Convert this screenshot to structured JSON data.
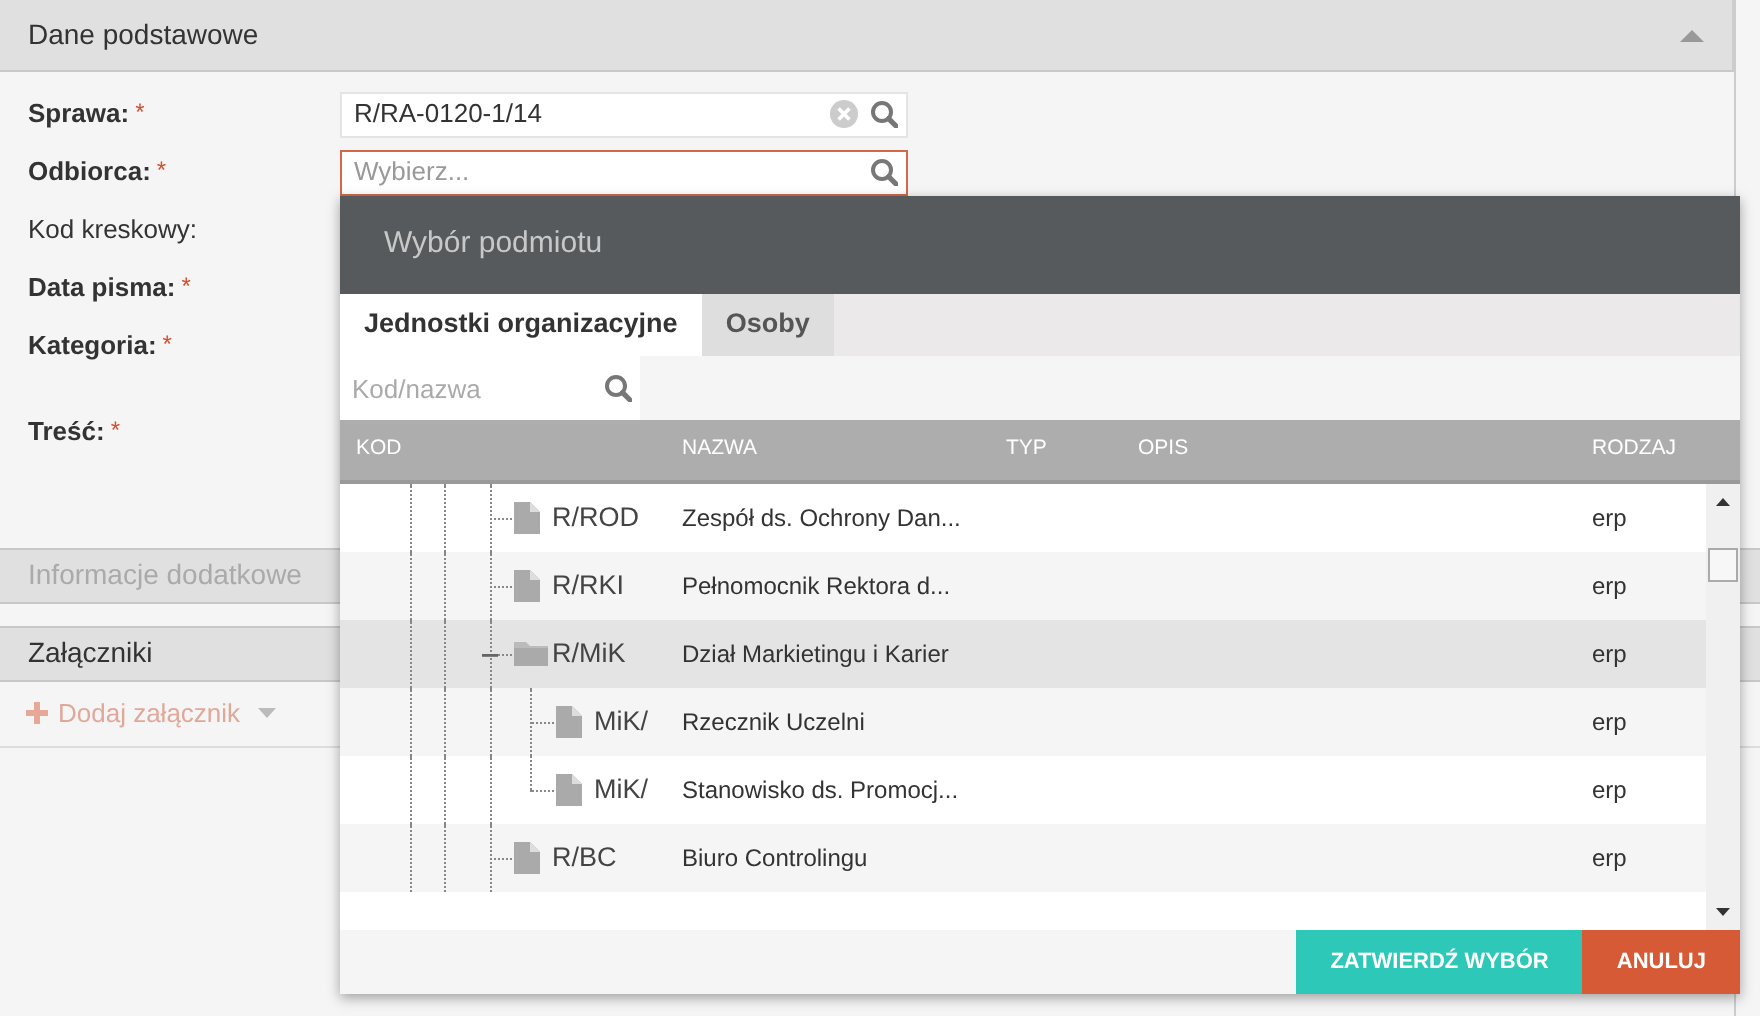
{
  "section": {
    "title": "Dane podstawowe",
    "expanded": true
  },
  "form": [
    {
      "label": "Sprawa:",
      "required": true,
      "required_mark": "*",
      "kind": "value",
      "value": "R/RA-0120-1/14",
      "focused": false
    },
    {
      "label": "Odbiorca:",
      "required": true,
      "required_mark": "*",
      "kind": "placeholder",
      "placeholder": "Wybierz...",
      "focused": true
    },
    {
      "label": "Kod kreskowy:",
      "required": false,
      "kind": "hidden"
    },
    {
      "label": "Data pisma:",
      "required": true,
      "required_mark": "*",
      "kind": "hidden"
    },
    {
      "label": "Kategoria:",
      "required": true,
      "required_mark": "*",
      "kind": "hidden"
    },
    {
      "label": "Treść:",
      "required": true,
      "required_mark": "*",
      "kind": "area"
    }
  ],
  "sections_below": [
    {
      "title": "Informacje dodatkowe",
      "disabled": true
    },
    {
      "title": "Załączniki",
      "disabled": false
    }
  ],
  "add_attachment": {
    "label": "Dodaj załącznik",
    "disabled": true
  },
  "dialog": {
    "title": "Wybór podmiotu",
    "tabs": [
      {
        "label": "Jednostki organizacyjne",
        "selected": true
      },
      {
        "label": "Osoby",
        "selected": false
      }
    ],
    "search": {
      "placeholder": "Kod/nazwa"
    },
    "columns": [
      "KOD",
      "NAZWA",
      "TYP",
      "OPIS",
      "RODZAJ"
    ],
    "rows": [
      {
        "kind": "document",
        "code": "R/ROD",
        "name": "Zespół ds. Ochrony Dan...",
        "rodzaj": "erp",
        "selected": false
      },
      {
        "kind": "document",
        "code": "R/RKI",
        "name": "Pełnomocnik Rektora d...",
        "rodzaj": "erp",
        "selected": false
      },
      {
        "kind": "folder",
        "code": "R/MiK",
        "name": "Dział Markietingu i Karier",
        "rodzaj": "erp",
        "selected": true,
        "expanded": true,
        "children": [
          {
            "kind": "document",
            "code": "MiK/",
            "name": "Rzecznik Uczelni",
            "rodzaj": "erp",
            "selected": false
          },
          {
            "kind": "document",
            "code": "MiK/",
            "name": "Stanowisko ds. Promocj...",
            "rodzaj": "erp",
            "selected": false
          }
        ]
      },
      {
        "kind": "document",
        "code": "R/BC",
        "name": "Biuro Controlingu",
        "rodzaj": "erp",
        "selected": false
      }
    ],
    "buttons": [
      {
        "label": "ZATWIERDŹ WYBÓR",
        "kind": "confirm"
      },
      {
        "label": "ANULUJ",
        "kind": "cancel"
      }
    ]
  }
}
